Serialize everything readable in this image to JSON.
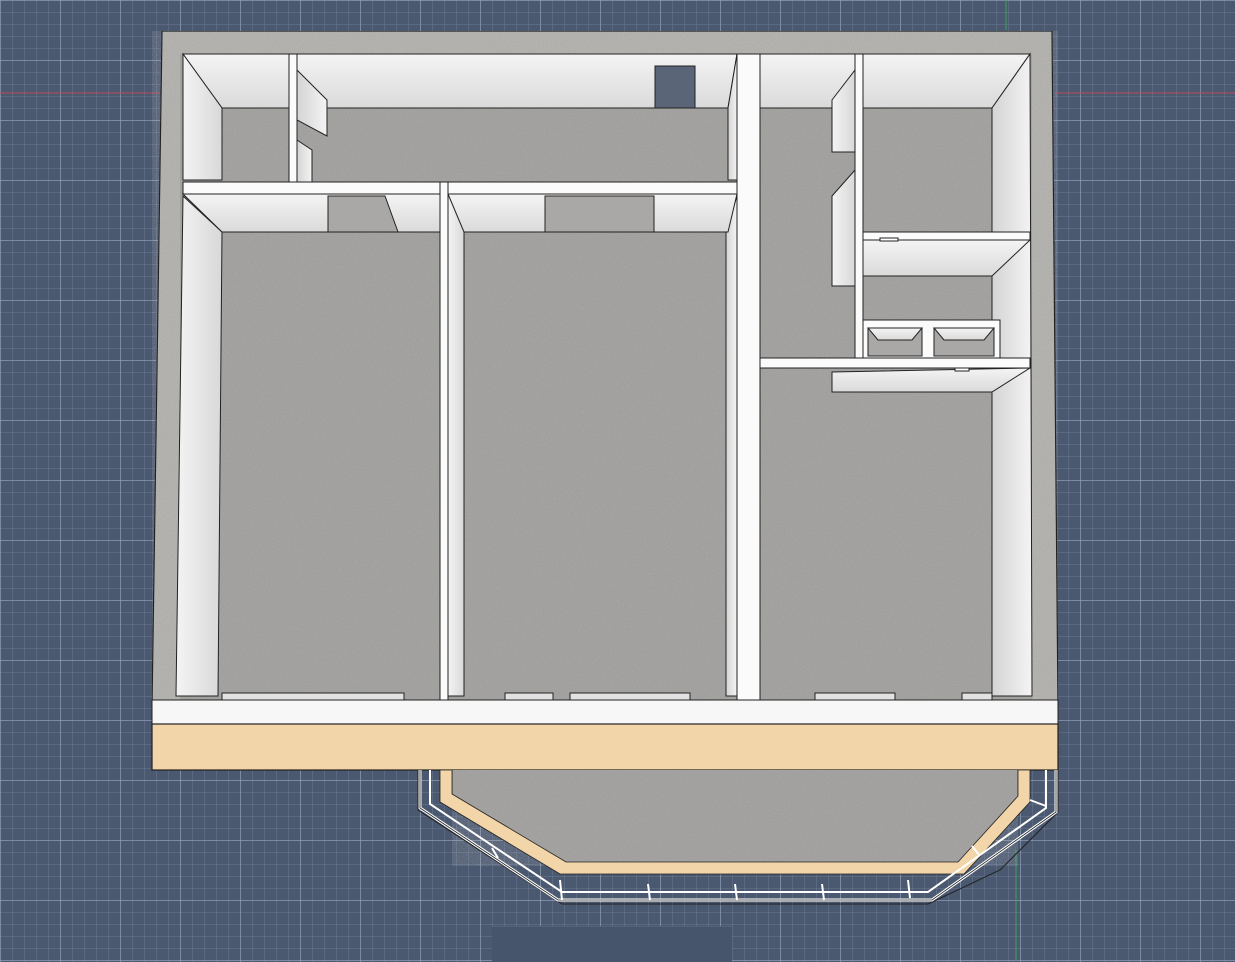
{
  "app": {
    "view_mode": "3D top-down",
    "status_text": ""
  },
  "colors": {
    "background": "#4a5870",
    "grid_line": "#96a5be",
    "axis_x": "#c04a5a",
    "axis_y": "#3aa35a",
    "outer_slab": "#b9b8b4",
    "floor": "#a9a8a6",
    "wall_top": "#ffffff",
    "wall_face": "#e6e6e6",
    "beam": "#f2d5a8",
    "railing": "#ffffff"
  },
  "scene": {
    "rooms": [
      {
        "id": "hall"
      },
      {
        "id": "room-left"
      },
      {
        "id": "room-center"
      },
      {
        "id": "room-right"
      },
      {
        "id": "service-room"
      },
      {
        "id": "bath-1"
      },
      {
        "id": "bath-2"
      },
      {
        "id": "balcony"
      }
    ],
    "icons": [
      "floor-plan-model-icon",
      "balcony-railing-icon"
    ]
  }
}
